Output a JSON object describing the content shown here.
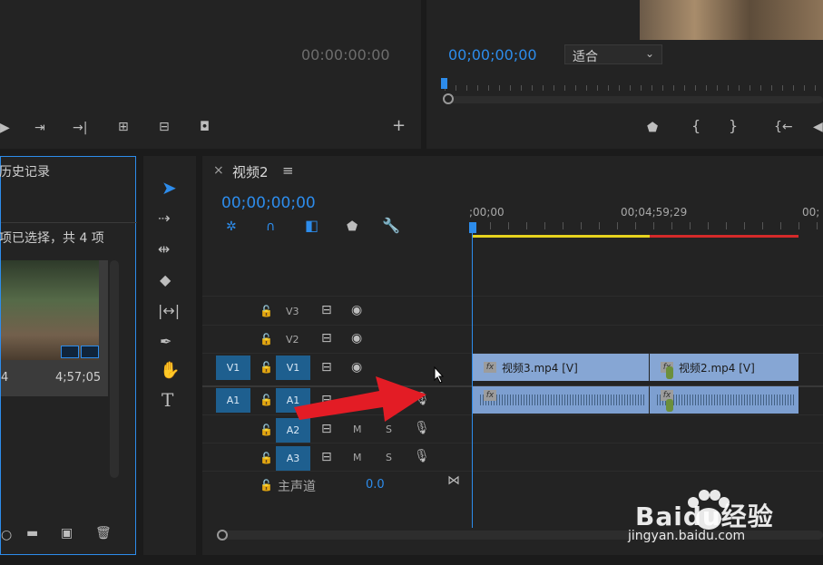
{
  "source_monitor": {
    "timecode": "00:00:00:00"
  },
  "program_monitor": {
    "timecode": "00;00;00;00",
    "fit_label": "适合",
    "fit_arrow": "⌄"
  },
  "project_panel": {
    "tab_label": "历史记录",
    "selection_info": "项已选择，共 4 项",
    "clip_left_text": "4",
    "clip_duration": "4;57;05"
  },
  "timeline": {
    "close_symbol": "×",
    "sequence_name": "视频2",
    "menu_symbol": "≡",
    "timecode": "00;00;00;00",
    "ruler_labels": [
      ";00;00",
      "00;04;59;29",
      "00;"
    ],
    "tracks": {
      "v3": "V3",
      "v2": "V2",
      "v1": "V1",
      "v1_src": "V1",
      "a1": "A1",
      "a1_src": "A1",
      "a2": "A2",
      "a3": "A3",
      "m": "M",
      "s": "S"
    },
    "master": {
      "label": "主声道",
      "value": "0.0"
    },
    "clips": {
      "video1": "视频3.mp4 [V]",
      "video2": "视频2.mp4 [V]",
      "fx": "fx"
    }
  },
  "tools": [
    "selection-tool",
    "track-select-tool",
    "ripple-edit-tool",
    "razor-tool",
    "slip-tool",
    "pen-tool",
    "hand-tool",
    "type-tool"
  ],
  "watermark": {
    "brand": "Baidu经验",
    "url": "jingyan.baidu.com"
  },
  "colors": {
    "accent": "#2d8ceb",
    "clip_video": "#86a6d4",
    "clip_audio": "#7d9fd0",
    "work_area_yellow": "#e6d21e",
    "work_area_red": "#d42a2a",
    "annotation_arrow": "#e31c25"
  }
}
